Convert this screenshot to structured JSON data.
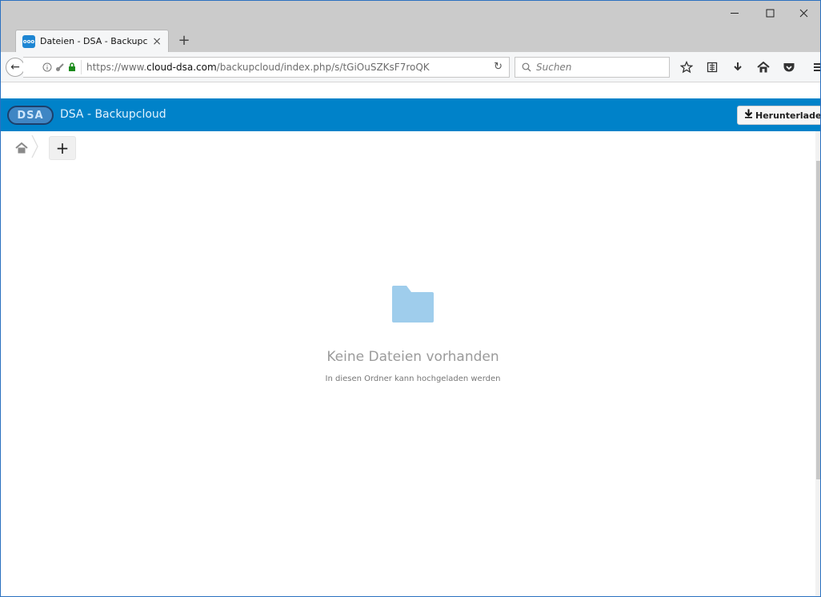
{
  "window": {
    "minimize_icon": "minimize-icon",
    "maximize_icon": "maximize-icon",
    "close_icon": "close-icon"
  },
  "tab": {
    "favicon_text": "ooo",
    "title": "Dateien - DSA - Backupclo...",
    "close": "×",
    "new_tab": "+"
  },
  "navbar": {
    "back": "←",
    "url_prefix": "https://www.",
    "url_domain": "cloud-dsa.com",
    "url_path": "/backupcloud/index.php/s/tGiOuSZKsF7roQK",
    "reload": "↻",
    "search_placeholder": "Suchen",
    "tools": [
      "bookmark-star-icon",
      "reading-list-icon",
      "downloads-icon",
      "home-icon",
      "pocket-icon",
      "menu-icon"
    ]
  },
  "header": {
    "logo_text": "DSA",
    "title": "DSA - Backupcloud",
    "download_label": "Herunterladen",
    "brand_color": "#0082c9"
  },
  "breadcrumb": {
    "add_label": "+"
  },
  "empty_state": {
    "title": "Keine Dateien vorhanden",
    "subtitle": "In diesen Ordner kann hochgeladen werden",
    "folder_color": "#9fcdec"
  }
}
